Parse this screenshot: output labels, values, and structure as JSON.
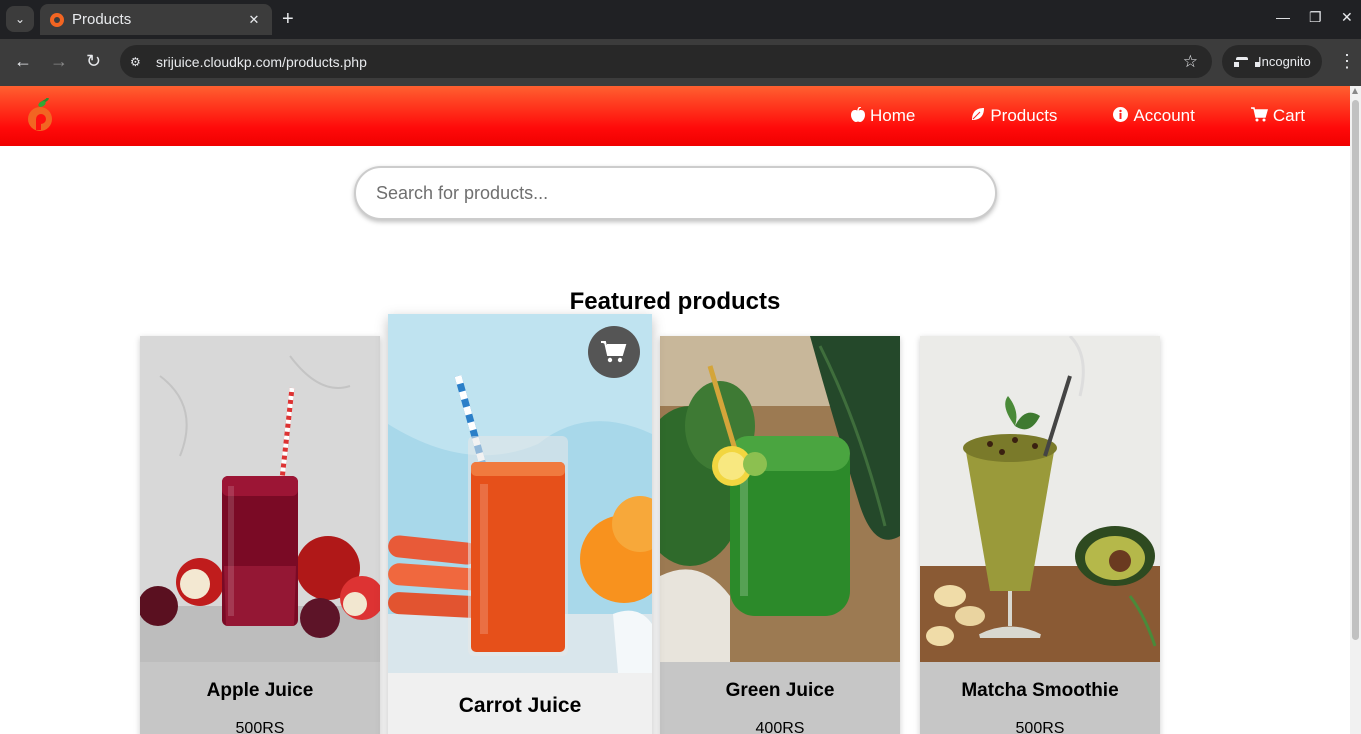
{
  "browser": {
    "tab_title": "Products",
    "url": "srijuice.cloudkp.com/products.php",
    "incognito_label": "Incognito"
  },
  "nav": {
    "items": [
      {
        "label": "Home",
        "icon": "apple-icon"
      },
      {
        "label": "Products",
        "icon": "leaf-icon"
      },
      {
        "label": "Account",
        "icon": "info-circle-icon"
      },
      {
        "label": "Cart",
        "icon": "cart-icon"
      }
    ]
  },
  "search": {
    "placeholder": "Search for products..."
  },
  "featured": {
    "title": "Featured products",
    "products": [
      {
        "name": "Apple Juice",
        "price": "500RS"
      },
      {
        "name": "Carrot Juice",
        "price": ""
      },
      {
        "name": "Green Juice",
        "price": "400RS"
      },
      {
        "name": "Matcha Smoothie",
        "price": "500RS"
      }
    ]
  },
  "colors": {
    "header": "#ff0a0a",
    "card_bg": "#c6c6c6",
    "card_hover_bg": "#f0f0f0"
  }
}
